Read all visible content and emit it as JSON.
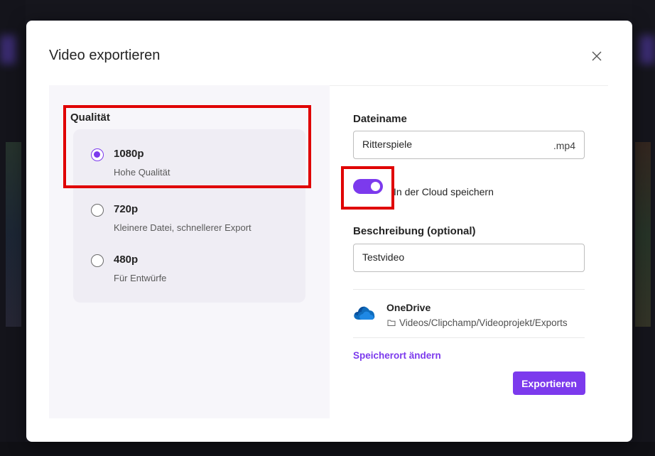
{
  "dialog": {
    "title": "Video exportieren"
  },
  "quality": {
    "label": "Qualität",
    "options": [
      {
        "title": "1080p",
        "subtitle": "Hohe Qualität",
        "selected": true
      },
      {
        "title": "720p",
        "subtitle": "Kleinere Datei, schnellerer Export",
        "selected": false
      },
      {
        "title": "480p",
        "subtitle": "Für Entwürfe",
        "selected": false
      }
    ]
  },
  "filename": {
    "label": "Dateiname",
    "value": "Ritterspiele",
    "extension": ".mp4"
  },
  "cloud": {
    "toggle_on": true,
    "label": "In der Cloud speichern"
  },
  "description": {
    "label": "Beschreibung (optional)",
    "value": "Testvideo"
  },
  "location": {
    "service": "OneDrive",
    "path": "Videos/Clipchamp/Videoprojekt/Exports",
    "change_link": "Speicherort ändern"
  },
  "actions": {
    "export_label": "Exportieren"
  },
  "colors": {
    "accent": "#7c3aed",
    "highlight": "#e00000"
  },
  "icons": {
    "close": "close-icon",
    "onedrive": "onedrive-cloud-icon",
    "folder": "folder-icon"
  }
}
